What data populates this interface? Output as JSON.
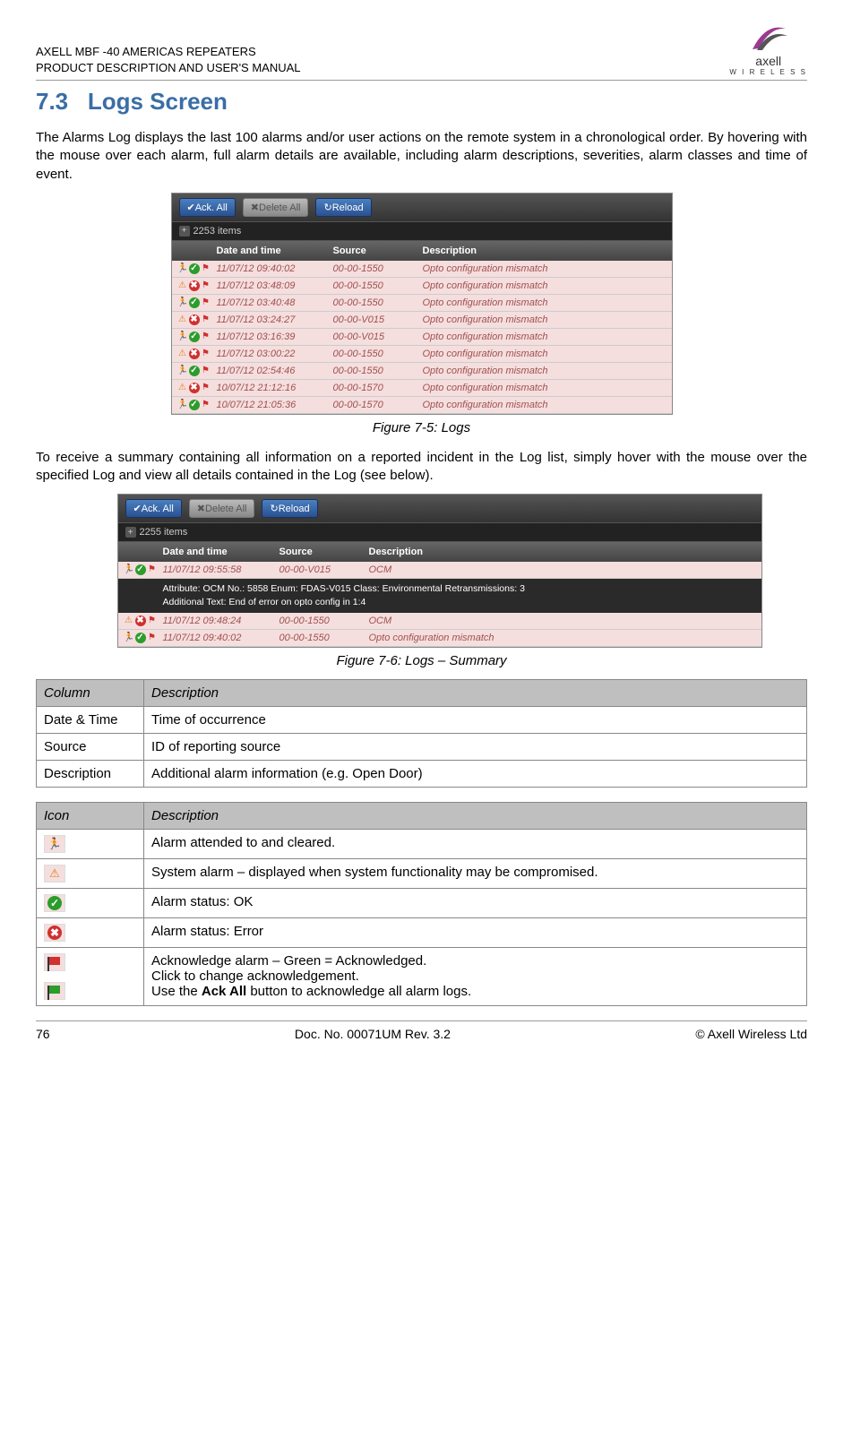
{
  "header": {
    "line1": "AXELL MBF -40 AMERICAS REPEATERS",
    "line2": "PRODUCT DESCRIPTION AND USER'S MANUAL",
    "logo_text_1": "axell",
    "logo_text_2": "W I R E L E S S"
  },
  "section": {
    "number": "7.3",
    "title": "Logs Screen"
  },
  "para1": "The Alarms Log displays the last 100 alarms and/or user actions on the remote system in a chronological order. By hovering with the mouse over each alarm, full alarm details are available, including alarm descriptions, severities, alarm classes and time of event.",
  "screenshot1": {
    "btn_ack": "✔Ack. All",
    "btn_delete": "✖Delete All",
    "btn_reload": "↻Reload",
    "items_count": "2253 items",
    "headers": {
      "dt": "Date and time",
      "src": "Source",
      "desc": "Description"
    },
    "rows": [
      {
        "icons": "ok",
        "dt": "11/07/12 09:40:02",
        "src": "00-00-1550",
        "desc": "Opto configuration mismatch"
      },
      {
        "icons": "warn",
        "dt": "11/07/12 03:48:09",
        "src": "00-00-1550",
        "desc": "Opto configuration mismatch"
      },
      {
        "icons": "ok",
        "dt": "11/07/12 03:40:48",
        "src": "00-00-1550",
        "desc": "Opto configuration mismatch"
      },
      {
        "icons": "warn",
        "dt": "11/07/12 03:24:27",
        "src": "00-00-V015",
        "desc": "Opto configuration mismatch"
      },
      {
        "icons": "ok",
        "dt": "11/07/12 03:16:39",
        "src": "00-00-V015",
        "desc": "Opto configuration mismatch"
      },
      {
        "icons": "warn",
        "dt": "11/07/12 03:00:22",
        "src": "00-00-1550",
        "desc": "Opto configuration mismatch"
      },
      {
        "icons": "ok",
        "dt": "11/07/12 02:54:46",
        "src": "00-00-1550",
        "desc": "Opto configuration mismatch"
      },
      {
        "icons": "warn",
        "dt": "10/07/12 21:12:16",
        "src": "00-00-1570",
        "desc": "Opto configuration mismatch"
      },
      {
        "icons": "ok",
        "dt": "10/07/12 21:05:36",
        "src": "00-00-1570",
        "desc": "Opto configuration mismatch"
      }
    ]
  },
  "figcap1": "Figure 7-5:  Logs",
  "para2": "To receive a summary containing all information on a reported incident in the Log list, simply hover with the mouse over the specified Log and view all details contained in the Log (see below).",
  "screenshot2": {
    "btn_ack": "✔Ack. All",
    "btn_delete": "✖Delete All",
    "btn_reload": "↻Reload",
    "items_count": "2255 items",
    "headers": {
      "dt": "Date and time",
      "src": "Source",
      "desc": "Description"
    },
    "row0": {
      "dt": "11/07/12 09:55:58",
      "src": "00-00-V015",
      "desc": "OCM"
    },
    "detail_line1": "Attribute: OCM    No.: 5858    Enum: FDAS-V015    Class: Environmental    Retransmissions: 3",
    "detail_line2": "Additional Text: End of error on opto config in 1:4",
    "row1": {
      "dt": "11/07/12 09:48:24",
      "src": "00-00-1550",
      "desc": "OCM"
    },
    "row2": {
      "dt": "11/07/12 09:40:02",
      "src": "00-00-1550",
      "desc": "Opto configuration mismatch"
    }
  },
  "figcap2": "Figure 7-6: Logs – Summary",
  "table1": {
    "hcol": "Column",
    "hdesc": "Description",
    "r0c": "Date & Time",
    "r0d": "Time of occurrence",
    "r1c": "Source",
    "r1d": "ID of reporting source",
    "r2c": "Description",
    "r2d": "Additional alarm information (e.g. Open Door)"
  },
  "table2": {
    "hicon": "Icon",
    "hdesc": "Description",
    "r0d": "Alarm attended to and cleared.",
    "r1d": "System alarm – displayed when system functionality may be compromised.",
    "r2d": "Alarm status: OK",
    "r3d": "Alarm status: Error",
    "r4d1": "Acknowledge alarm – Green = Acknowledged.",
    "r4d2": "Click to change acknowledgement.",
    "r4d3_pre": "Use the ",
    "r4d3_bold": "Ack All",
    "r4d3_post": " button to acknowledge all alarm logs."
  },
  "footer": {
    "left": "76",
    "center": "Doc. No. 00071UM Rev. 3.2",
    "right": "© Axell Wireless Ltd"
  }
}
